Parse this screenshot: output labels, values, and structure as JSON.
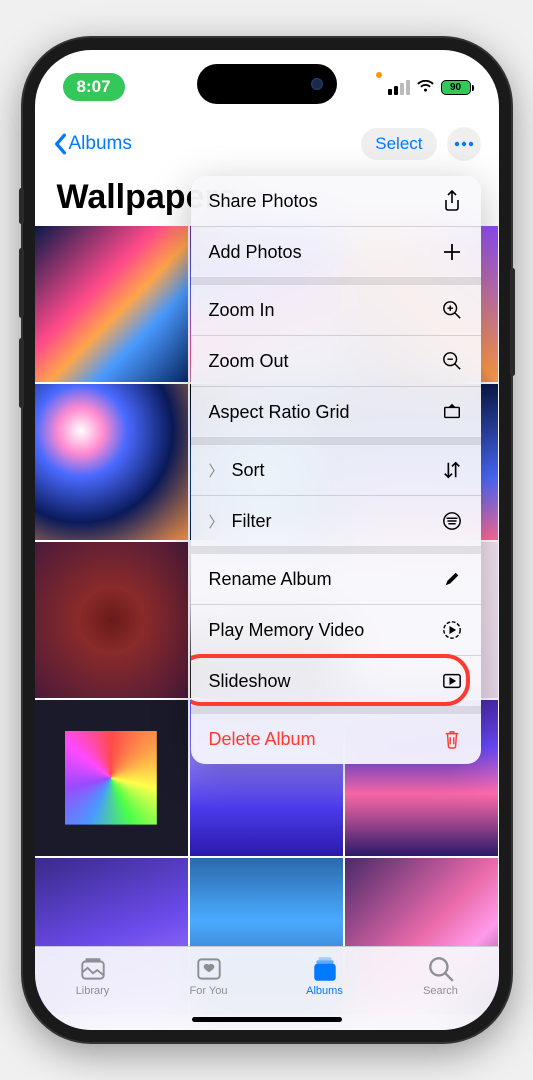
{
  "status": {
    "time": "8:07",
    "battery": "90"
  },
  "nav": {
    "back_label": "Albums",
    "select_label": "Select"
  },
  "title": "Wallpapers",
  "menu": {
    "share": "Share Photos",
    "add": "Add Photos",
    "zoom_in": "Zoom In",
    "zoom_out": "Zoom Out",
    "aspect": "Aspect Ratio Grid",
    "sort": "Sort",
    "filter": "Filter",
    "rename": "Rename Album",
    "play_memory": "Play Memory Video",
    "slideshow": "Slideshow",
    "delete": "Delete Album"
  },
  "tabs": {
    "library": "Library",
    "for_you": "For You",
    "albums": "Albums",
    "search": "Search"
  }
}
